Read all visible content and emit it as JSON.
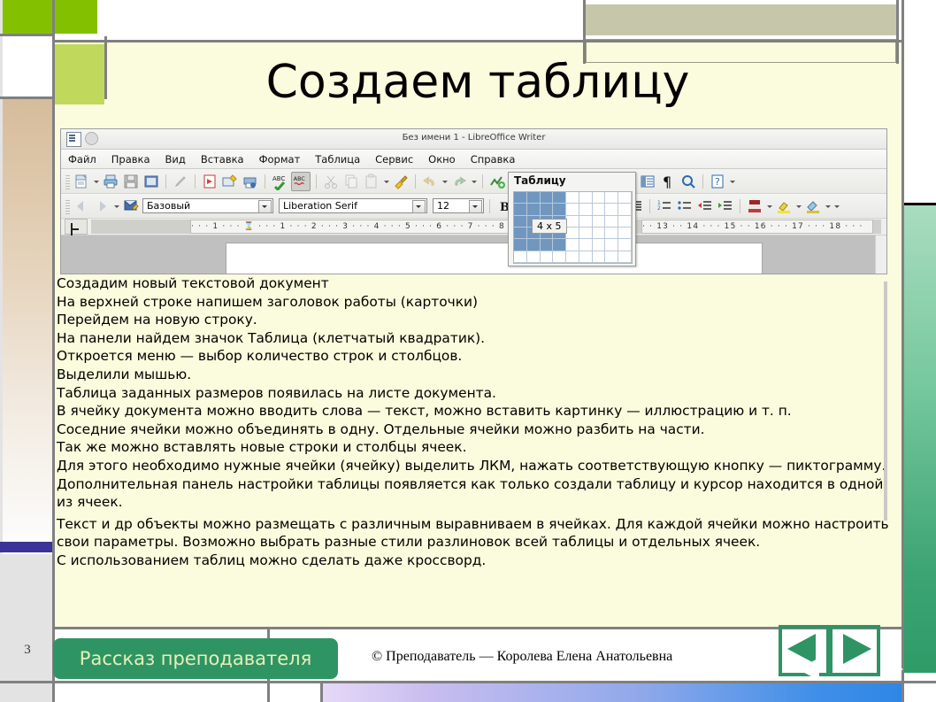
{
  "slide": {
    "title": "Создаем таблицу",
    "page_number": "3",
    "tag_label": "Рассказ преподавателя",
    "copyright": "© Преподаватель — Королева Елена Анатольевна"
  },
  "app_screenshot": {
    "titlebar": "Без имени 1 - LibreOffice Writer",
    "menu": [
      "Файл",
      "Правка",
      "Вид",
      "Вставка",
      "Формат",
      "Таблица",
      "Сервис",
      "Окно",
      "Справка"
    ],
    "style_combo": "Базовый",
    "font_combo": "Liberation Serif",
    "size_combo": "12",
    "ruler_left": "· · · 1 · · · ⌛ · · · 1 · · · 2 · · · 3 · · · 4 · · · 5 · · · 6 · · · 7 · · · 8",
    "ruler_right": "· · 13 · · 14 · · · 15 · · 16 · · · 17 · · · 18 · · ·",
    "table_popup": {
      "title": "Таблицу",
      "size_label": "4 x 5",
      "cols": 9,
      "rows": 6,
      "selected_cols": 4,
      "selected_rows": 5
    }
  },
  "body_lines": [
    "Создадим новый текстовой документ",
    "На верхней строке напишем  заголовок работы (карточки)",
    "Перейдем на новую строку.",
    "На панели  найдем значок Таблица  (клетчатый квадратик).",
    "Откроется меню — выбор количество строк и столбцов.",
    "Выделили мышью.",
    "Таблица заданных размеров появилась на листе документа.",
    "В ячейку документа можно вводить слова — текст, можно вставить картинку — иллюстрацию и т. п.",
    "Соседние ячейки можно объединять в одну. Отдельные ячейки можно разбить на части.",
    "Так же можно вставлять новые строки и столбцы ячеек.",
    "Для этого необходимо нужные ячейки (ячейку) выделить ЛКМ, нажать соответствующую кнопку — пиктограмму.",
    "Дополнительная панель  настройки таблицы появляется как только создали таблицу и курсор находится в одной из ячеек.",
    "Текст и др объекты можно размещать с различным выравниваем в ячейках. Для каждой ячейки можно настроить свои параметры.  Возможно выбрать разные стили разлиновок всей таблицы и отдельных ячеек.",
    "С использованием таблиц  можно сделать даже кроссворд."
  ],
  "colors": {
    "accent_green": "#2f9464",
    "bright_green": "#83c000",
    "light_green": "#c0d95c",
    "slide_bg": "#fbfbdd",
    "tan": "#c6c6aa",
    "navy": "#3b3397"
  },
  "nav": {
    "prev": "prev-slide",
    "next": "next-slide"
  }
}
